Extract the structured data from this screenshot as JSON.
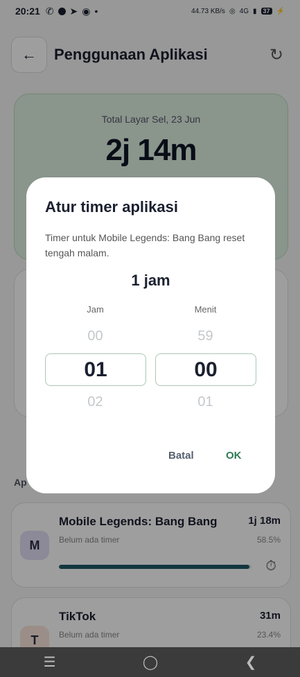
{
  "status": {
    "time": "20:21",
    "network": "44.73 KB/s",
    "signal": "4G",
    "battery": "37"
  },
  "header": {
    "title": "Penggunaan Aplikasi"
  },
  "summary": {
    "label": "Total Layar Sel, 23 Jun",
    "value": "2j 14m"
  },
  "section": {
    "label": "Ap"
  },
  "apps": [
    {
      "initial": "M",
      "name": "Mobile Legends: Bang Bang",
      "time": "1j 18m",
      "sub": "Belum ada timer",
      "pct": "58.5%",
      "usage": 0.99,
      "avatar_bg": "#e3def6"
    },
    {
      "initial": "T",
      "name": "TikTok",
      "time": "31m",
      "sub": "Belum ada timer",
      "pct": "23.4%",
      "avatar_bg": "#fbe6dc"
    }
  ],
  "dialog": {
    "title": "Atur timer aplikasi",
    "description": "Timer untuk Mobile Legends: Bang Bang reset tengah malam.",
    "selected": "1 jam",
    "hours": {
      "label": "Jam",
      "prev": "00",
      "current": "01",
      "next": "02"
    },
    "minutes": {
      "label": "Menit",
      "prev": "59",
      "current": "00",
      "next": "01"
    },
    "cancel": "Batal",
    "ok": "OK"
  },
  "colors": {
    "accent": "#2f7a55",
    "progress": "#1f5a66"
  }
}
